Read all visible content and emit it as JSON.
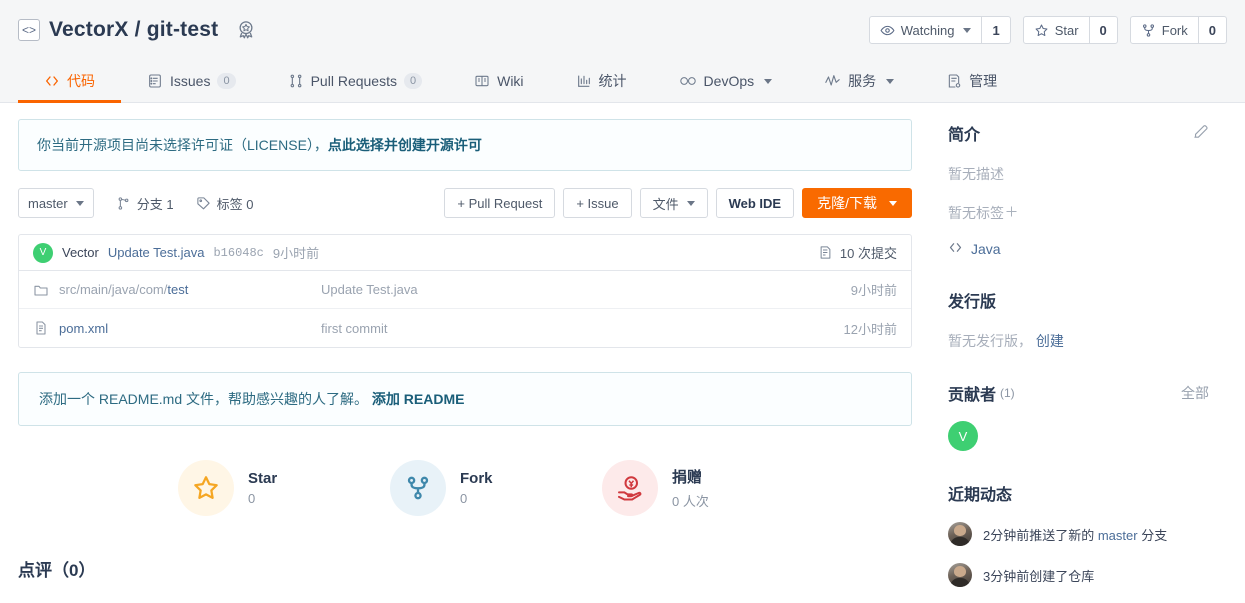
{
  "header": {
    "repo_icon": "code-brackets-icon",
    "owner": "VectorX",
    "separator": "/",
    "repo": "git-test",
    "full_title": "VectorX / git-test",
    "badge_icon": "medal-badge-icon",
    "buttons": [
      {
        "icon": "eye-icon",
        "label": "Watching",
        "count": "1",
        "has_caret": true
      },
      {
        "icon": "star-outline-icon",
        "label": "Star",
        "count": "0",
        "has_caret": false
      },
      {
        "icon": "fork-icon",
        "label": "Fork",
        "count": "0",
        "has_caret": false
      }
    ]
  },
  "nav": {
    "active_color": "#fa6400",
    "items": [
      {
        "icon": "code-icon",
        "label": "代码",
        "count": null,
        "caret": false,
        "active": true
      },
      {
        "icon": "issues-icon",
        "label": "Issues",
        "count": "0",
        "caret": false,
        "active": false
      },
      {
        "icon": "pull-request-icon",
        "label": "Pull Requests",
        "count": "0",
        "caret": false,
        "active": false
      },
      {
        "icon": "wiki-book-icon",
        "label": "Wiki",
        "count": null,
        "caret": false,
        "active": false
      },
      {
        "icon": "chart-bar-icon",
        "label": "统计",
        "count": null,
        "caret": false,
        "active": false
      },
      {
        "icon": "infinity-icon",
        "label": "DevOps",
        "count": null,
        "caret": true,
        "active": false
      },
      {
        "icon": "activity-pulse-icon",
        "label": "服务",
        "count": null,
        "caret": true,
        "active": false
      },
      {
        "icon": "clipboard-settings-icon",
        "label": "管理",
        "count": null,
        "caret": false,
        "active": false
      }
    ]
  },
  "license_notice": {
    "text": "你当前开源项目尚未选择许可证（LICENSE），",
    "link": "点此选择并创建开源许可"
  },
  "toolbar": {
    "branch": "master",
    "branch_icon": "branch-icon",
    "branches_label": "分支 1",
    "tags_icon": "tag-icon",
    "tags_label": "标签 0",
    "pull_request_btn": "+ Pull Request",
    "issue_btn": "+ Issue",
    "files_btn": "文件",
    "web_ide_btn": "Web IDE",
    "clone_btn": "克隆/下载"
  },
  "commit_bar": {
    "avatar_initial": "V",
    "author": "Vector",
    "message": "Update Test.java",
    "sha": "b16048c",
    "time": "9小时前",
    "commits_icon": "commit-list-icon",
    "commits_label": "10 次提交"
  },
  "files": [
    {
      "icon": "folder-icon",
      "name_prefix": "src/main/java/com/",
      "name_link": "test",
      "message": "Update Test.java",
      "time": "9小时前"
    },
    {
      "icon": "file-icon",
      "name_prefix": "",
      "name_link": "pom.xml",
      "message": "first commit",
      "time": "12小时前"
    }
  ],
  "readme_notice": {
    "text": "添加一个 README.md 文件，帮助感兴趣的人了解。",
    "link": "添加 README"
  },
  "actions": [
    {
      "icon": "star-icon",
      "label": "Star",
      "value": "0",
      "circle_color": "#fff6e6",
      "icon_color": "#f5a623"
    },
    {
      "icon": "fork-icon",
      "label": "Fork",
      "value": "0",
      "circle_color": "#e8f2f8",
      "icon_color": "#3f88ab"
    },
    {
      "icon": "donate-hand-yuan-icon",
      "label": "捐赠",
      "value": "0 人次",
      "circle_color": "#fdeaea",
      "icon_color": "#d0393e"
    }
  ],
  "comments": {
    "title": "点评（0）"
  },
  "sidebar": {
    "about": {
      "title": "简介",
      "edit_icon": "edit-pencil-icon",
      "description": "暂无描述",
      "tags": "暂无标签",
      "add_tag_icon": "plus-icon",
      "language_icon": "code-icon",
      "language": "Java"
    },
    "releases": {
      "title": "发行版",
      "empty": "暂无发行版，",
      "create_link": "创建"
    },
    "contributors": {
      "title": "贡献者",
      "count": "(1)",
      "all_link": "全部",
      "avatars": [
        {
          "initial": "V"
        }
      ]
    },
    "activity": {
      "title": "近期动态",
      "items": [
        {
          "avatar": "user-photo-avatar",
          "prefix": "2分钟前推送了新的 ",
          "highlight": "master",
          "suffix": " 分支"
        },
        {
          "avatar": "user-photo-avatar",
          "prefix": "3分钟前创建了仓库",
          "highlight": "",
          "suffix": ""
        }
      ]
    }
  }
}
